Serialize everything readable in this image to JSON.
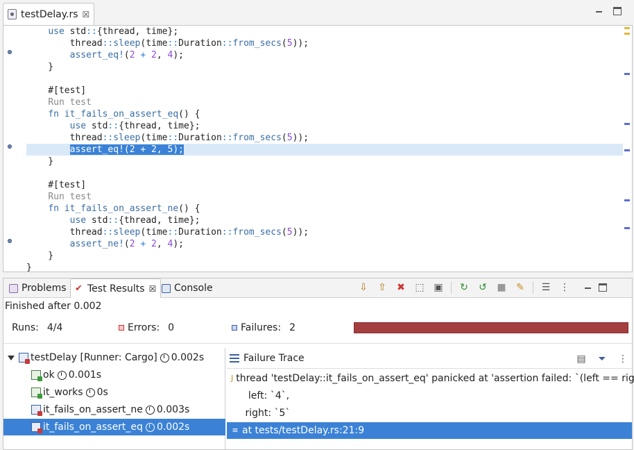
{
  "editor": {
    "tab_label": "testDelay.rs",
    "tab_close": "☒",
    "lines": [
      [
        "",
        "    ",
        [
          "kw",
          "use"
        ],
        " std",
        [
          "op",
          "::"
        ],
        "{thread, time};"
      ],
      [
        "",
        "        thread",
        [
          "op",
          "::"
        ],
        [
          "fn",
          "sleep"
        ],
        "(time",
        [
          "op",
          "::"
        ],
        "Duration",
        [
          "op",
          "::"
        ],
        [
          "fn",
          "from_secs"
        ],
        "(",
        [
          "num",
          "5"
        ],
        "));"
      ],
      [
        "",
        "        ",
        [
          "fn",
          "assert_eq!"
        ],
        "(",
        [
          "num",
          "2"
        ],
        " ",
        [
          "op",
          "+"
        ],
        " ",
        [
          "num",
          "2"
        ],
        ", ",
        [
          "num",
          "4"
        ],
        ");"
      ],
      [
        "",
        "    }"
      ],
      [
        "",
        ""
      ],
      [
        "",
        "    #[test]"
      ],
      [
        "",
        "    ",
        [
          "muted",
          "Run test"
        ]
      ],
      [
        "",
        "    ",
        [
          "kw",
          "fn"
        ],
        " ",
        [
          "fn",
          "it_fails_on_assert_eq"
        ],
        "() {"
      ],
      [
        "",
        "        ",
        [
          "kw",
          "use"
        ],
        " std",
        [
          "op",
          "::"
        ],
        "{thread, time};"
      ],
      [
        "",
        "        thread",
        [
          "op",
          "::"
        ],
        [
          "fn",
          "sleep"
        ],
        "(time",
        [
          "op",
          "::"
        ],
        "Duration",
        [
          "op",
          "::"
        ],
        [
          "fn",
          "from_secs"
        ],
        "(",
        [
          "num",
          "5"
        ],
        "));"
      ],
      [
        "sel",
        "        ",
        [
          "hl",
          "assert_eq!(2 + 2, 5);"
        ]
      ],
      [
        "",
        "    }"
      ],
      [
        "",
        ""
      ],
      [
        "",
        "    #[test]"
      ],
      [
        "",
        "    ",
        [
          "muted",
          "Run test"
        ]
      ],
      [
        "",
        "    ",
        [
          "kw",
          "fn"
        ],
        " ",
        [
          "fn",
          "it_fails_on_assert_ne"
        ],
        "() {"
      ],
      [
        "",
        "        ",
        [
          "kw",
          "use"
        ],
        " std",
        [
          "op",
          "::"
        ],
        "{thread, time};"
      ],
      [
        "",
        "        thread",
        [
          "op",
          "::"
        ],
        [
          "fn",
          "sleep"
        ],
        "(time",
        [
          "op",
          "::"
        ],
        "Duration",
        [
          "op",
          "::"
        ],
        [
          "fn",
          "from_secs"
        ],
        "(",
        [
          "num",
          "5"
        ],
        "));"
      ],
      [
        "",
        "        ",
        [
          "fn",
          "assert_ne!"
        ],
        "(",
        [
          "num",
          "2"
        ],
        " ",
        [
          "op",
          "+"
        ],
        " ",
        [
          "num",
          "2"
        ],
        ", ",
        [
          "num",
          "4"
        ],
        ");"
      ],
      [
        "",
        "    }"
      ],
      [
        "",
        "}"
      ]
    ]
  },
  "views": {
    "tabs": [
      "Problems",
      "Test Results",
      "Console"
    ],
    "active_tab_close": "☒"
  },
  "results": {
    "status": "Finished after 0.002",
    "runs_label": "Runs:",
    "runs_value": "4/4",
    "errors_label": "Errors:",
    "errors_value": "0",
    "failures_label": "Failures:",
    "failures_value": "2",
    "progress_color": "#a33f3f"
  },
  "tree": {
    "root": {
      "label": "testDelay [Runner: Cargo]",
      "time": "0.002s"
    },
    "items": [
      {
        "label": "ok",
        "time": "0.001s",
        "status": "pass"
      },
      {
        "label": "it_works",
        "time": "0s",
        "status": "pass"
      },
      {
        "label": "it_fails_on_assert_ne",
        "time": "0.003s",
        "status": "fail"
      },
      {
        "label": "it_fails_on_assert_eq",
        "time": "0.002s",
        "status": "fail"
      }
    ]
  },
  "trace": {
    "title": "Failure Trace",
    "lines": [
      "thread 'testDelay::it_fails_on_assert_eq' panicked at 'assertion failed: `(left == right)`",
      "  left: `4`,",
      " right: `5`",
      "at tests/testDelay.rs:21:9"
    ]
  }
}
